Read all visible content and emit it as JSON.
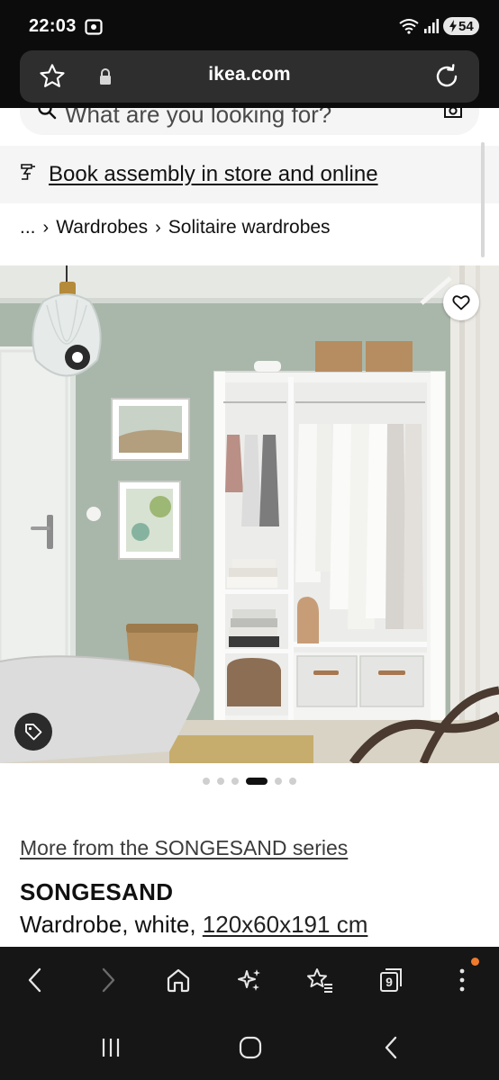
{
  "status_bar": {
    "time": "22:03",
    "battery": "54"
  },
  "browser": {
    "url": "ikea.com"
  },
  "page": {
    "search_placeholder": "What are you looking for?",
    "assembly_link": "Book assembly in store and online",
    "breadcrumb": {
      "ellipsis": "...",
      "items": [
        "Wardrobes",
        "Solitaire wardrobes"
      ]
    },
    "carousel": {
      "total": 6,
      "active_index": 3
    },
    "series_link": "More from the SONGESAND series",
    "product": {
      "name": "SONGESAND",
      "description": "Wardrobe, white,",
      "size": "120x60x191 cm"
    }
  },
  "bottom_toolbar": {
    "tab_count": "9"
  }
}
